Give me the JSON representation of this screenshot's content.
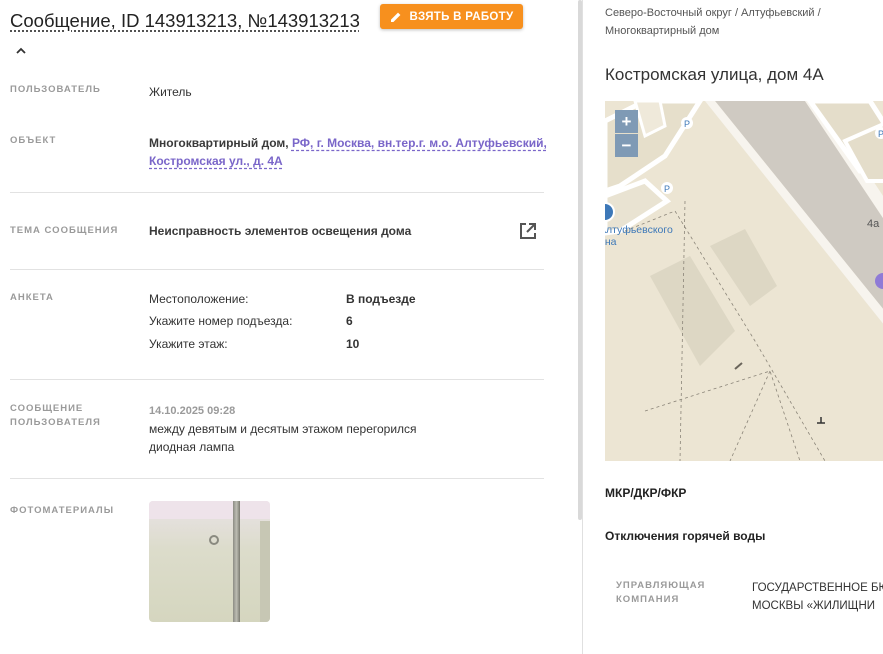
{
  "header": {
    "title": "Сообщение, ID 143913213, №143913213",
    "take_button": "ВЗЯТЬ В РАБОТУ"
  },
  "user": {
    "label": "ПОЛЬЗОВАТЕЛЬ",
    "value": "Житель"
  },
  "object": {
    "label": "ОБЪЕКТ",
    "type": "Многоквартирный дом,",
    "address_line1": "РФ, г. Москва, вн.тер.г. м.о. Алтуфьевский,",
    "address_line2": "Костромская ул., д. 4А"
  },
  "topic": {
    "label": "ТЕМА СООБЩЕНИЯ",
    "value": "Неисправность элементов освещения дома"
  },
  "survey": {
    "label": "АНКЕТА",
    "rows": [
      {
        "key": "Местоположение:",
        "value": "В подъезде"
      },
      {
        "key": "Укажите номер подъезда:",
        "value": "6"
      },
      {
        "key": "Укажите этаж:",
        "value": "10"
      }
    ]
  },
  "user_message": {
    "label_line1": "СООБЩЕНИЕ",
    "label_line2": "ПОЛЬЗОВАТЕЛЯ",
    "timestamp": "14.10.2025 09:28",
    "text_line1": "между девятым и десятым этажом перегорился",
    "text_line2": "диодная лампа"
  },
  "photos": {
    "label": "ФОТОМАТЕРИАЛЫ"
  },
  "right": {
    "breadcrumb_line1": "Северо-Восточный округ / Алтуфьевский /",
    "breadcrumb_line2": "Многоквартирный дом",
    "address": "Костромская улица, дом 4А",
    "map": {
      "zoom_in": "+",
      "zoom_out": "−",
      "place_label_line1": "Алтуфьевского",
      "place_label_line2": "она",
      "house_number": "4а",
      "parking_mark": "P"
    },
    "section1": "МКР/ДКР/ФКР",
    "section2": "Отключения горячей воды",
    "mgmt_label_line1": "УПРАВЛЯЮЩАЯ",
    "mgmt_label_line2": "КОМПАНИЯ",
    "mgmt_value_line1": "ГОСУДАРСТВЕННОЕ БЮ",
    "mgmt_value_line2": "МОСКВЫ «ЖИЛИЩНИ"
  },
  "colors": {
    "accent": "#f7901e",
    "link": "#7a66c9",
    "map_zoom": "#7f9ab5"
  },
  "icons": [
    "chevron-up-icon",
    "pencil-icon",
    "external-link-icon",
    "lamp-icon"
  ]
}
